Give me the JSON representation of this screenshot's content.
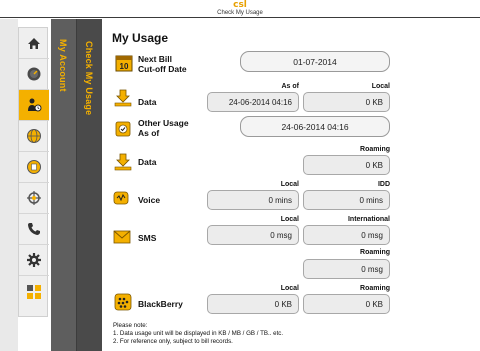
{
  "header": {
    "brand": "csl",
    "subtitle": "Check My Usage"
  },
  "sidebar": {
    "icons": [
      {
        "name": "home-icon"
      },
      {
        "name": "gauge-icon"
      },
      {
        "name": "usage-person-icon",
        "active": true
      },
      {
        "name": "globe-icon"
      },
      {
        "name": "clock-icon"
      },
      {
        "name": "gear-compass-icon"
      },
      {
        "name": "phone-icon"
      },
      {
        "name": "settings-icon"
      },
      {
        "name": "apps-icon"
      }
    ],
    "accent_color": "#f4b000"
  },
  "panels": {
    "my_account": "My Account",
    "check_my_usage": "Check My Usage"
  },
  "main": {
    "title": "My Usage",
    "next_bill": {
      "label_line1": "Next Bill",
      "label_line2": "Cut-off Date",
      "value": "01-07-2014",
      "calendar_day": "10"
    },
    "data_local": {
      "label": "Data",
      "head_asof": "As of",
      "head_local": "Local",
      "asof_value": "24-06-2014 04:16",
      "local_value": "0 KB"
    },
    "other_usage": {
      "label_line1": "Other Usage",
      "label_line2": "As of",
      "value": "24-06-2014 04:16"
    },
    "data_roaming": {
      "label": "Data",
      "head_roaming": "Roaming",
      "roaming_value": "0 KB"
    },
    "voice": {
      "label": "Voice",
      "head_local": "Local",
      "head_idd": "IDD",
      "local_value": "0 mins",
      "idd_value": "0 mins"
    },
    "sms": {
      "label": "SMS",
      "head_local": "Local",
      "head_international": "International",
      "local_value": "0 msg",
      "international_value": "0 msg",
      "head_roaming": "Roaming",
      "roaming_value": "0 msg"
    },
    "blackberry": {
      "label": "BlackBerry",
      "head_local": "Local",
      "head_roaming": "Roaming",
      "local_value": "0 KB",
      "roaming_value": "0 KB"
    },
    "notes": {
      "heading": "Please note:",
      "line1": "1. Data usage unit will be displayed in KB / MB / GB / TB.. etc.",
      "line2": "2. For reference only, subject to bill records."
    }
  }
}
